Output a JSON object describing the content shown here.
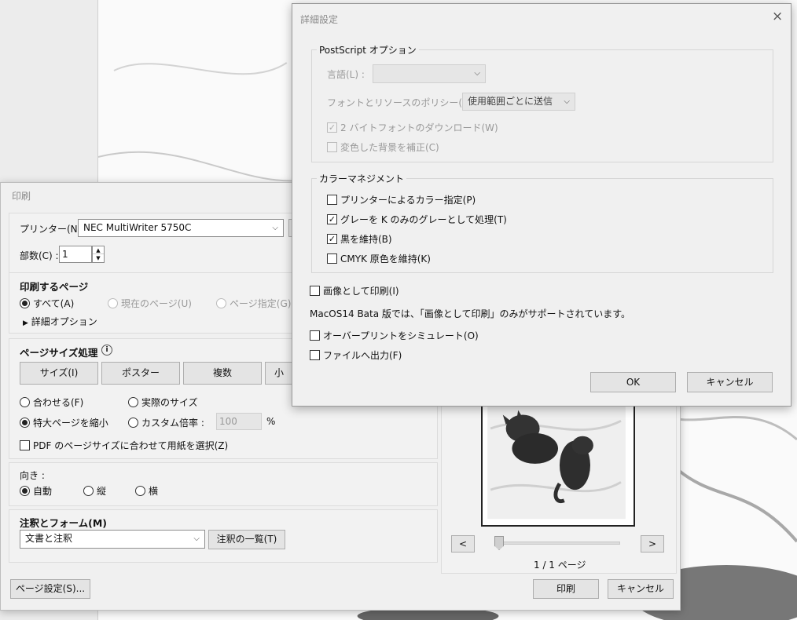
{
  "print_dialog": {
    "title": "印刷",
    "printer_label": "プリンター(N) :",
    "printer_value": "NEC MultiWriter 5750C",
    "copies_label": "部数(C) :",
    "copies_value": "1",
    "pages_section": {
      "title": "印刷するページ",
      "all": "すべて(A)",
      "current": "現在のページ(U)",
      "range": "ページ指定(G)",
      "more_options": "詳細オプション"
    },
    "page_sizing": {
      "title": "ページサイズ処理",
      "buttons": [
        "サイズ(I)",
        "ポスター",
        "複数",
        "小"
      ],
      "fit": "合わせる(F)",
      "actual_size": "実際のサイズ",
      "shrink": "特大ページを縮小",
      "custom_scale": "カスタム倍率 :",
      "custom_scale_value": "100",
      "percent": "%",
      "choose_paper": "PDF のページサイズに合わせて用紙を選択(Z)"
    },
    "orientation": {
      "title": "向き :",
      "auto": "自動",
      "portrait": "縦",
      "landscape": "横"
    },
    "comments_forms": {
      "title": "注釈とフォーム(M)",
      "value": "文書と注釈",
      "summary_button": "注釈の一覧(T)"
    },
    "preview": {
      "prev": "<",
      "next": ">",
      "page_counter": "1 / 1 ページ"
    },
    "page_setup_button": "ページ設定(S)...",
    "print_button": "印刷",
    "cancel_button": "キャンセル"
  },
  "advanced_dialog": {
    "title": "詳細設定",
    "close": "×",
    "postscript": {
      "legend": "PostScript オプション",
      "language_label": "言語(L) :",
      "font_policy_label": "フォントとリソースのポリシー(N) :",
      "font_policy_value": "使用範囲ごとに送信",
      "download_2byte": "2 バイトフォントのダウンロード(W)",
      "discolor_bg": "変色した背景を補正(C)"
    },
    "color_management": {
      "legend": "カラーマネジメント",
      "printer_color": "プリンターによるカラー指定(P)",
      "gray_as_k": "グレーを K のみのグレーとして処理(T)",
      "keep_black": "黒を維持(B)",
      "keep_cmyk": "CMYK 原色を維持(K)"
    },
    "print_as_image": "画像として印刷(I)",
    "macos_note": "MacOS14 Bata 版では、「画像として印刷」のみがサポートされています。",
    "simulate_overprint": "オーバープリントをシミュレート(O)",
    "print_to_file": "ファイルへ出力(F)",
    "ok_button": "OK",
    "cancel_button": "キャンセル"
  }
}
